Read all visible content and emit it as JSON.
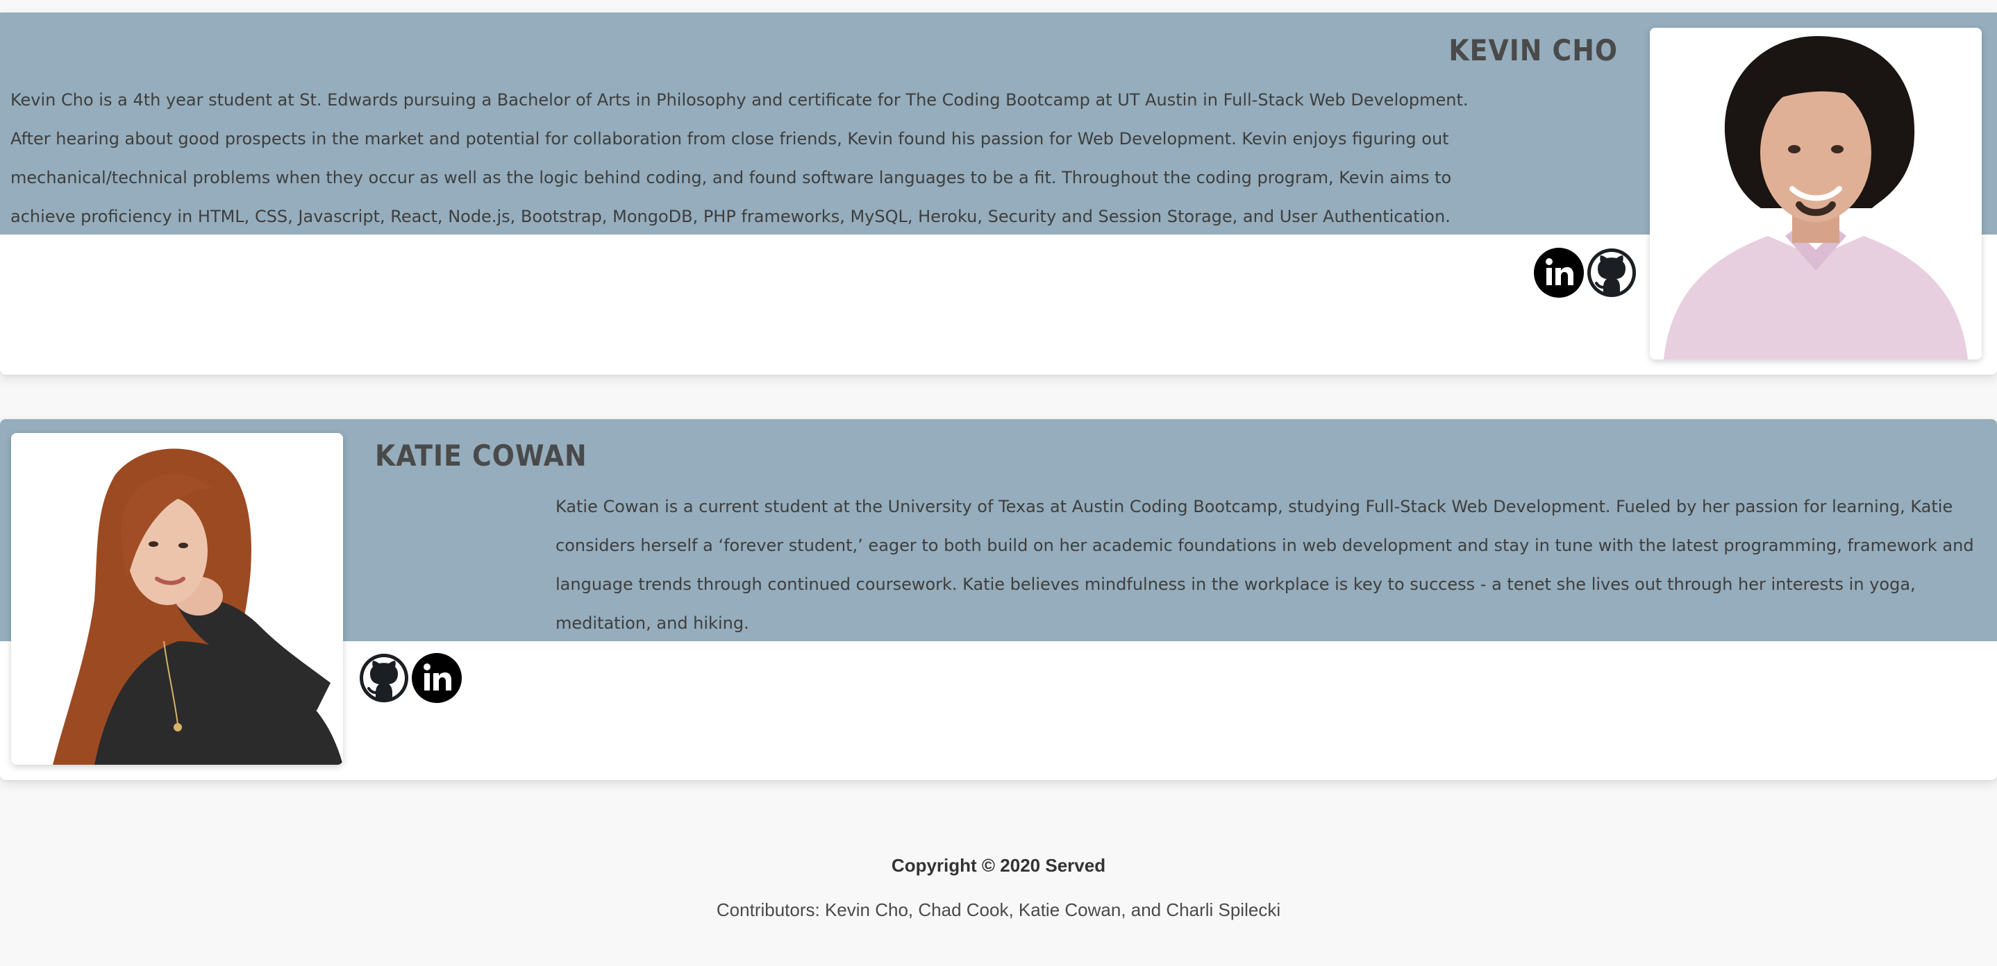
{
  "members": [
    {
      "name": "KEVIN CHO",
      "bio": "Kevin Cho is a 4th year student at St. Edwards pursuing a Bachelor of Arts in Philosophy and certificate for The Coding Bootcamp at UT Austin in Full-Stack Web Development. After hearing about good prospects in the market and potential for collaboration from close friends, Kevin found his passion for Web Development. Kevin enjoys figuring out mechanical/technical problems when they occur as well as the logic behind coding, and found software languages to be a fit. Throughout the coding program, Kevin aims to achieve proficiency in HTML, CSS, Javascript, React, Node.js, Bootstrap, MongoDB, PHP frameworks, MySQL, Heroku, Security and Session Storage, and User Authentication.",
      "social_order": [
        "linkedin-icon",
        "github-icon"
      ]
    },
    {
      "name": "KATIE COWAN",
      "bio": "Katie Cowan is a current student at the University of Texas at Austin Coding Bootcamp, studying Full-Stack Web Development. Fueled by her passion for learning, Katie considers herself a ‘forever student,’ eager to both build on her academic foundations in web development and stay in tune with the latest programming, framework and language trends through continued coursework. Katie believes mindfulness in the workplace is key to success - a tenet she lives out through her interests in yoga, meditation, and hiking.",
      "social_order": [
        "github-icon",
        "linkedin-icon"
      ]
    }
  ],
  "footer": {
    "copyright": "Copyright © 2020 Served",
    "contributors": "Contributors: Kevin Cho, Chad Cook, Katie Cowan, and Charli Spilecki"
  },
  "colors": {
    "band": "#95adbc",
    "name_text": "#4a4a4a",
    "page_background": "#f8f8f8"
  }
}
